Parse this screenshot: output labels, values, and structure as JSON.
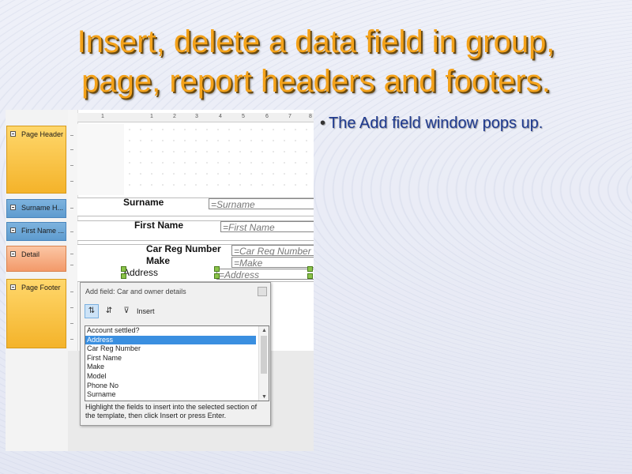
{
  "slide": {
    "title_line1": "Insert, delete a data field in group,",
    "title_line2": "page, report headers and footers.",
    "bullet": "The Add field window pops up."
  },
  "sections": {
    "page_header": "Page Header",
    "surname_header": "Surname H...",
    "firstname_header": "First Name ...",
    "detail": "Detail",
    "page_footer": "Page Footer"
  },
  "ruler": {
    "numbers": [
      "1",
      "1",
      "2",
      "3",
      "4",
      "5",
      "6",
      "7",
      "8"
    ]
  },
  "report": {
    "surname_label": "Surname",
    "surname_field": "=Surname",
    "firstname_label": "First Name",
    "firstname_field": "=First Name",
    "carreg_label": "Car Reg Number",
    "carreg_field": "=Car Reg Number",
    "make_label": "Make",
    "make_field": "=Make",
    "address_label": "Address",
    "address_field": "=Address"
  },
  "dialog": {
    "title": "Add field: Car and owner details",
    "insert_label": "Insert",
    "items": [
      {
        "label": "Account settled?",
        "selected": false
      },
      {
        "label": "Address",
        "selected": true
      },
      {
        "label": "Car Reg Number",
        "selected": false
      },
      {
        "label": "First Name",
        "selected": false
      },
      {
        "label": "Make",
        "selected": false
      },
      {
        "label": "Model",
        "selected": false
      },
      {
        "label": "Phone No",
        "selected": false
      },
      {
        "label": "Surname",
        "selected": false
      }
    ],
    "hint": "Highlight the fields to insert into the selected section of the template, then click Insert or press Enter."
  },
  "colors": {
    "title": "#f4a21a",
    "bullet": "#1f3a8f",
    "section_orange": "#f4b32a",
    "section_blue": "#5e9bcf",
    "section_salmon": "#f39a6a",
    "selection": "#3a8fe0"
  }
}
